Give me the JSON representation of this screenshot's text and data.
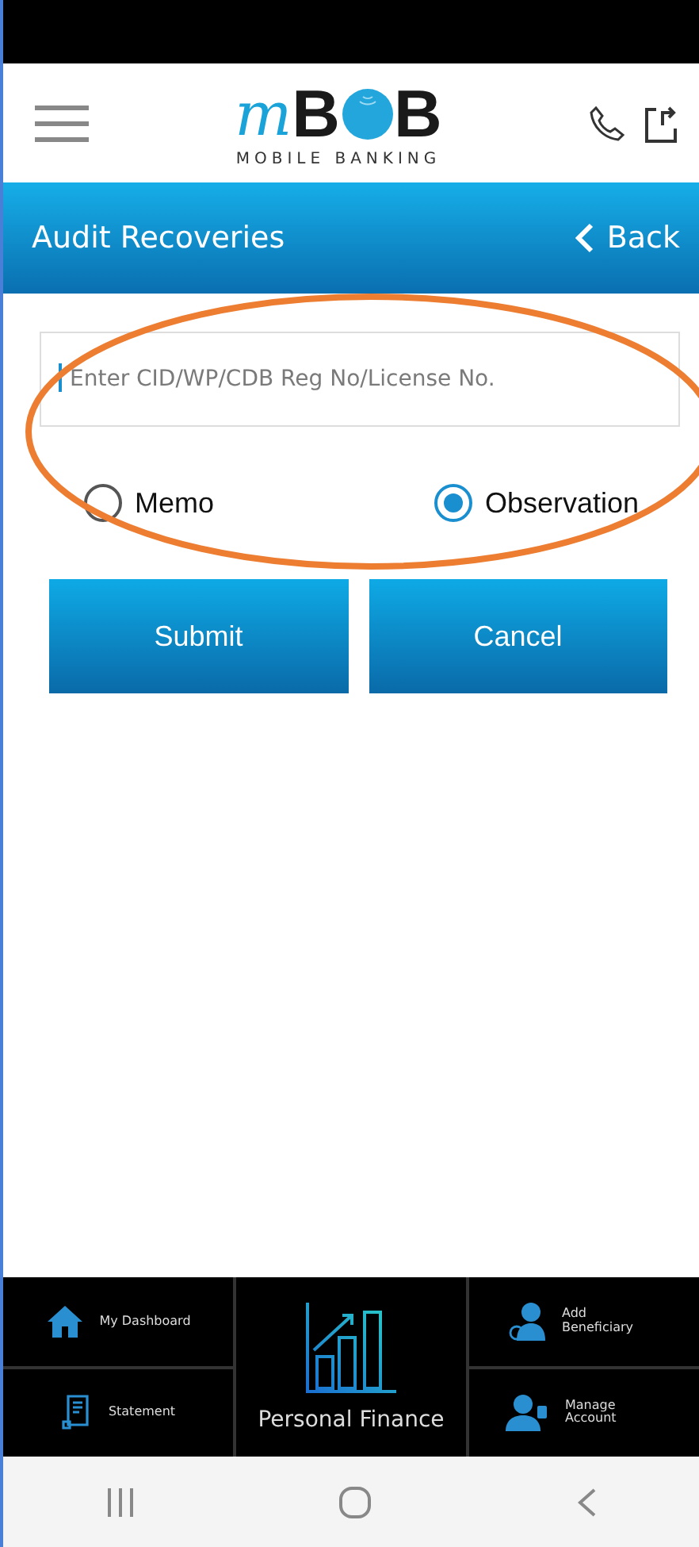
{
  "header": {
    "logo": {
      "script_letter": "m",
      "letter_before": "B",
      "letter_after": "B",
      "tagline": "MOBILE BANKING"
    }
  },
  "title_bar": {
    "title": "Audit Recoveries",
    "back_label": "Back"
  },
  "form": {
    "id_field": {
      "placeholder": "Enter CID/WP/CDB Reg No/License No.",
      "focused": true
    },
    "options": [
      {
        "label": "Memo",
        "selected": false
      },
      {
        "label": "Observation",
        "selected": true
      }
    ],
    "buttons": [
      "Submit",
      "Cancel"
    ]
  },
  "annotation": {
    "kind": "ellipse",
    "color": "#ed7d31"
  },
  "bottom_menu": {
    "left": [
      {
        "label": "My Dashboard"
      },
      {
        "label": "Statement"
      }
    ],
    "center": {
      "label": "Personal Finance"
    },
    "right": [
      {
        "label": "Add Beneficiary"
      },
      {
        "label": "Manage Account"
      }
    ]
  }
}
